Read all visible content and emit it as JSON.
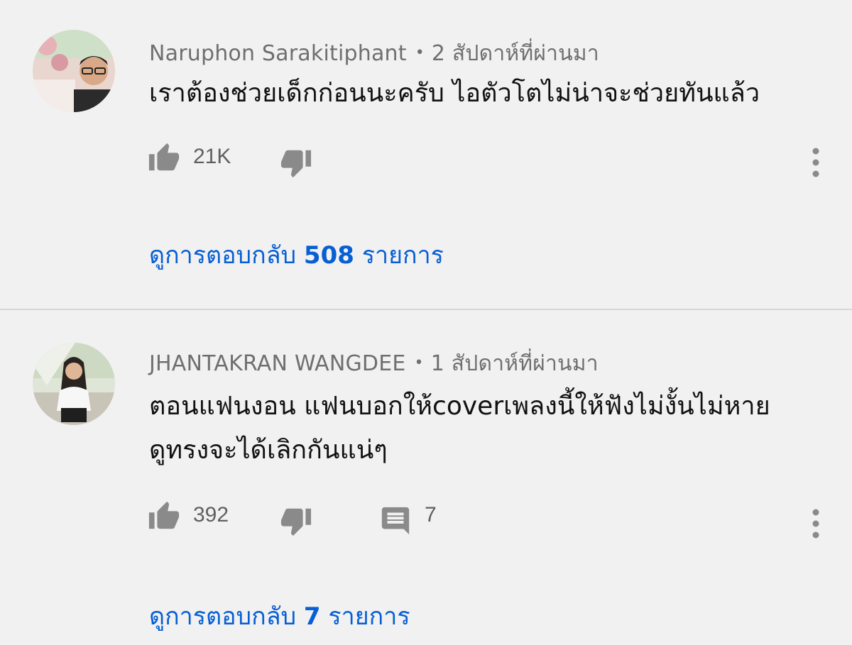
{
  "comments": [
    {
      "author": "Naruphon Sarakitiphant",
      "separator": "•",
      "time": "2 สัปดาห์ที่ผ่านมา",
      "text": "เราต้องช่วยเด็กก่อนนะครับ ไอตัวโตไม่น่าจะช่วยทันแล้ว",
      "likes": "21K",
      "replies_prefix": "ดูการตอบกลับ",
      "replies_count": "508",
      "replies_suffix": "รายการ"
    },
    {
      "author": "JHANTAKRAN WANGDEE",
      "separator": "•",
      "time": "1 สัปดาห์ที่ผ่านมา",
      "text_line1": "ตอนแฟนงอน แฟนบอกให้coverเพลงนี้ให้ฟังไม่งั้นไม่หาย",
      "text_line2": "ดูทรงจะได้เลิกกันแน่ๆ",
      "likes": "392",
      "reply_count_badge": "7",
      "replies_prefix": "ดูการตอบกลับ",
      "replies_count": "7",
      "replies_suffix": "รายการ"
    }
  ],
  "colors": {
    "background": "#f1f1f1",
    "link": "#065fd4",
    "meta": "#6f6f6f",
    "icon": "#8a8a8a"
  },
  "icons": [
    "like-icon",
    "dislike-icon",
    "comment-reply-icon",
    "more-options-icon"
  ]
}
